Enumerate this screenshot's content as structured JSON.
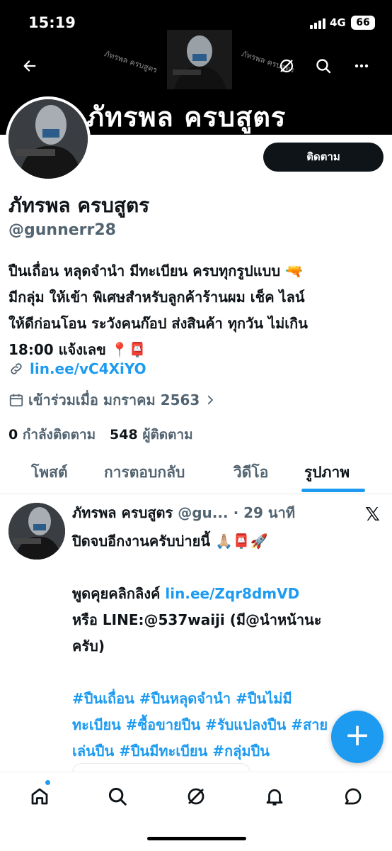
{
  "status_bar": {
    "time": "15:19",
    "network": "4G",
    "battery": "66"
  },
  "banner": {
    "title": "ภัทรพล ครบสูตร",
    "watermark_left": "ภัทรพล ครบสูตร",
    "watermark_right": "ภัทรพล ครบสูตร"
  },
  "header_icons": [
    "back-arrow-icon",
    "grok-icon",
    "search-icon",
    "more-icon"
  ],
  "profile": {
    "follow_label": "ติดตาม",
    "name": "ภัทรพล ครบสูตร",
    "handle": "@gunnerr28",
    "bio_lines": [
      "ปืนเถื่อน หลุดจำนำ มีทะเบียน ครบทุกรูปแบบ 🔫",
      "มีกลุ่ม ให้เข้า พิเศษสำหรับลูกค้าร้านผม เช็ค ไลน์",
      "ให้ดีก่อนโอน ระวังคนก๊อป ส่งสินค้า ทุกวัน ไม่เกิน",
      "18:00 แจ้งเลข 📍📮"
    ],
    "link": "lin.ee/vC4XiYO",
    "joined": "เข้าร่วมเมื่อ มกราคม 2563",
    "following_count": "0",
    "following_label": "กำลังติดตาม",
    "followers_count": "548",
    "followers_label": "ผู้ติดตาม"
  },
  "tabs": [
    {
      "label": "โพสต์",
      "active": false
    },
    {
      "label": "การตอบกลับ",
      "active": false
    },
    {
      "label": "วิดีโอ",
      "active": false
    },
    {
      "label": "รูปภาพ",
      "active": true
    }
  ],
  "post": {
    "name": "ภัทรพล ครบสูตร",
    "handle": "@gu...",
    "dot": "·",
    "time": "29 นาที",
    "lines": [
      "ปิดจบอีกงานครับบ่ายนี้ 🙏🏼📮🚀",
      "",
      "พูดคุยคลิกลิงค์",
      "หรือ LINE:@537waiji (มี@นำหน้านะ",
      "ครับ)",
      "",
      "#ปืนเถื่อน #ปืนหลุดจำนำ #ปืนไม่มี",
      "ทะเบียน #ซื้อขายปืน #รับแปลงปืน #สาย",
      "เล่นปืน #ปืนมีทะเบียน #กลุ่มปืน"
    ],
    "link": "lin.ee/Zqr8dmVD"
  },
  "fab_label": "+",
  "bottom_nav": [
    "home-icon",
    "search-icon",
    "grok-icon",
    "notifications-icon",
    "messages-icon"
  ]
}
